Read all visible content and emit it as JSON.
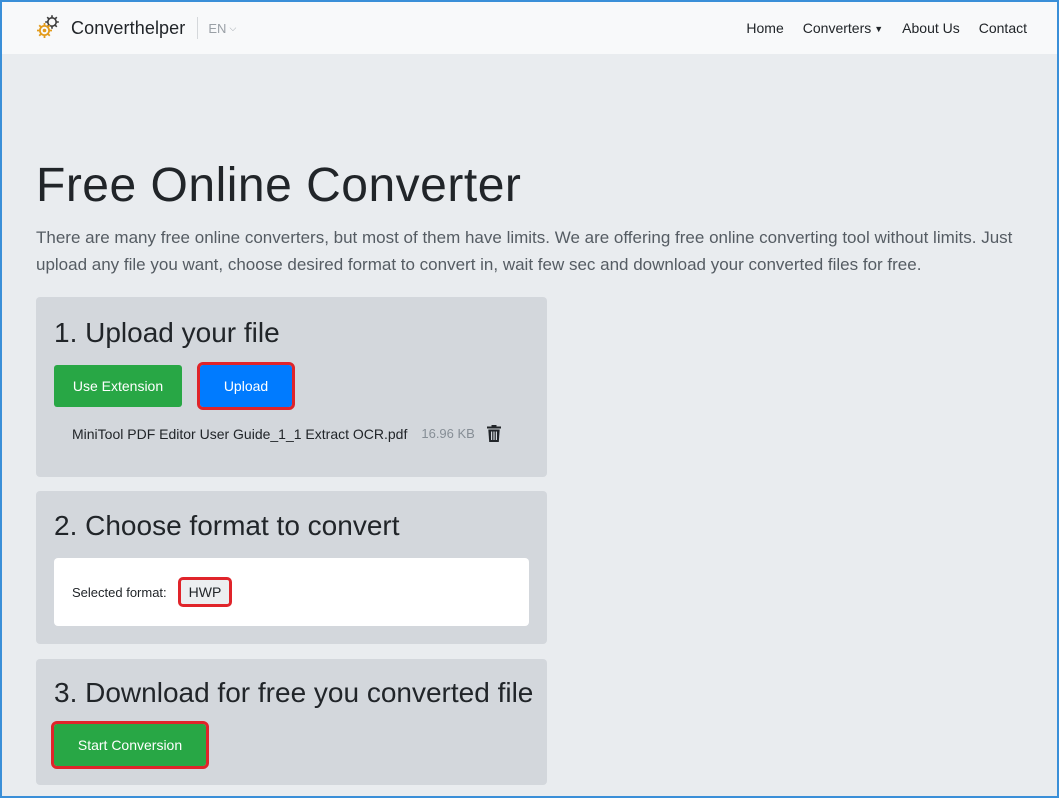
{
  "nav": {
    "brand": "Converthelper",
    "lang": "EN",
    "links": [
      {
        "label": "Home"
      },
      {
        "label": "Converters"
      },
      {
        "label": "About Us"
      },
      {
        "label": "Contact"
      }
    ]
  },
  "hero": {
    "title": "Free Online Converter",
    "lead": "There are many free online converters, but most of them have limits. We are offering free online converting tool without limits. Just upload any file you want, choose desired format to convert in, wait few sec and download your converted files for free."
  },
  "step1": {
    "heading": "1. Upload your file",
    "extension_label": "Use Extension",
    "upload_label": "Upload",
    "file": {
      "name": "MiniTool PDF Editor User Guide_1_1 Extract OCR.pdf",
      "size": "16.96 KB"
    }
  },
  "step2": {
    "heading": "2. Choose format to convert",
    "selected_label": "Selected format:",
    "selected_value": "HWP"
  },
  "step3": {
    "heading": "3. Download for free you converted file",
    "start_label": "Start Conversion"
  },
  "icons": {
    "logo": "gear-logo-icon",
    "delete": "trash-icon",
    "lang_dropdown": "chevron-down-icon",
    "converters_dropdown": "caret-down-icon"
  },
  "colors": {
    "primary_button": "#007bff",
    "success_button": "#28a745",
    "highlight": "#e0242a",
    "card_background": "#d3d7dc",
    "page_background": "#e9ecef"
  }
}
